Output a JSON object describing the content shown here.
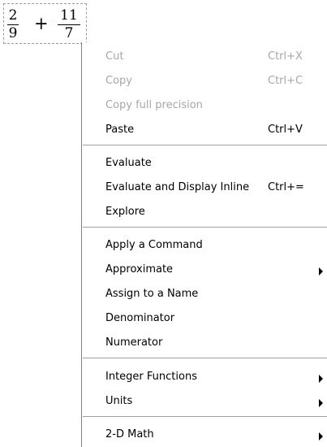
{
  "expression": {
    "frac1": {
      "num": "2",
      "den": "9"
    },
    "operator": "+",
    "frac2": {
      "num": "11",
      "den": "7"
    }
  },
  "menu": {
    "cut": {
      "label": "Cut",
      "shortcut": "Ctrl+X",
      "enabled": false
    },
    "copy": {
      "label": "Copy",
      "shortcut": "Ctrl+C",
      "enabled": false
    },
    "copy_full": {
      "label": "Copy full precision",
      "enabled": false
    },
    "paste": {
      "label": "Paste",
      "shortcut": "Ctrl+V",
      "enabled": true
    },
    "evaluate": {
      "label": "Evaluate"
    },
    "evaluate_inline": {
      "label": "Evaluate and Display Inline",
      "shortcut": "Ctrl+="
    },
    "explore": {
      "label": "Explore"
    },
    "apply_command": {
      "label": "Apply a Command"
    },
    "approximate": {
      "label": "Approximate",
      "submenu": true
    },
    "assign_name": {
      "label": "Assign to a Name"
    },
    "denominator": {
      "label": "Denominator"
    },
    "numerator": {
      "label": "Numerator"
    },
    "integer_functions": {
      "label": "Integer Functions",
      "submenu": true
    },
    "units": {
      "label": "Units",
      "submenu": true
    },
    "math_2d": {
      "label": "2-D Math",
      "submenu": true
    }
  },
  "icons": {
    "submenu_arrow": "chevron-right-icon"
  }
}
